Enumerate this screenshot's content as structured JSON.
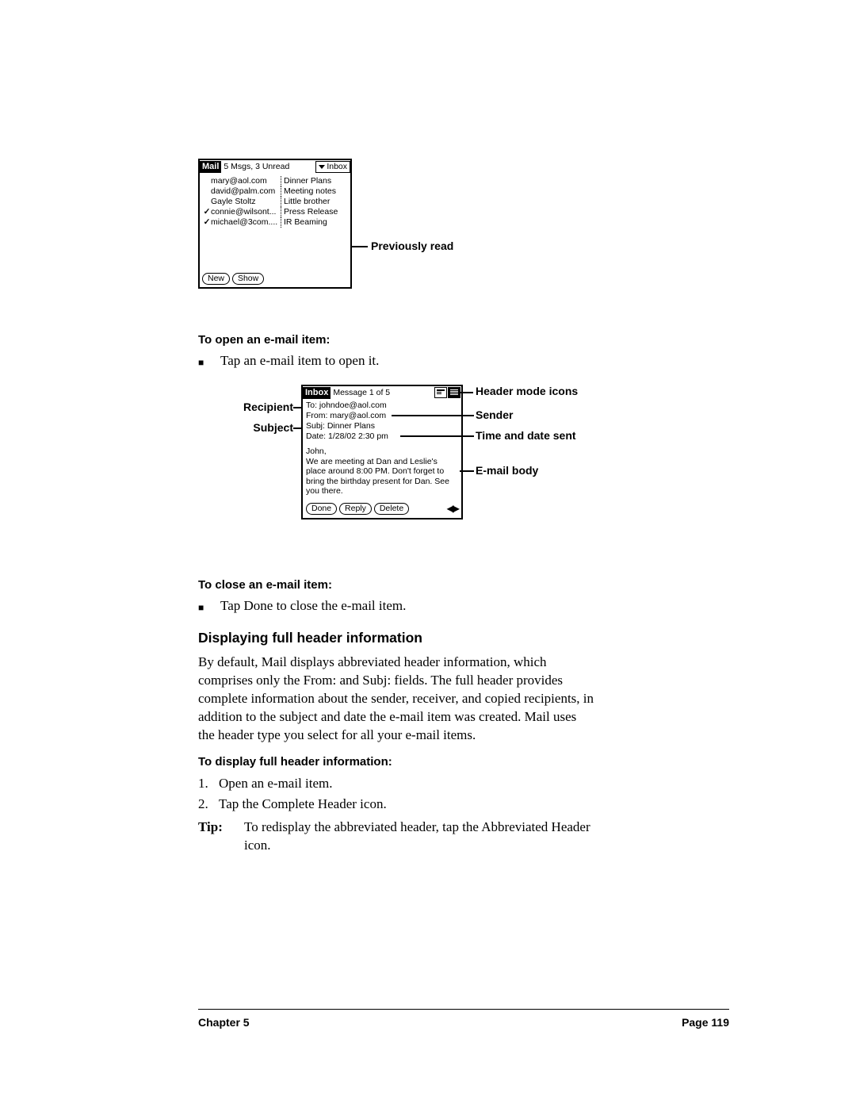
{
  "figure1": {
    "title": "Mail",
    "status": "5 Msgs, 3 Unread",
    "folder": "Inbox",
    "rows": [
      {
        "read": false,
        "sender": "mary@aol.com",
        "subject": "Dinner Plans"
      },
      {
        "read": false,
        "sender": "david@palm.com",
        "subject": "Meeting notes"
      },
      {
        "read": false,
        "sender": "Gayle Stoltz",
        "subject": "Little brother"
      },
      {
        "read": true,
        "sender": "connie@wilsont...",
        "subject": "Press Release"
      },
      {
        "read": true,
        "sender": "michael@3com....",
        "subject": "IR Beaming"
      }
    ],
    "btn_new": "New",
    "btn_show": "Show",
    "callout_read": "Previously read"
  },
  "open_heading": "To open an e-mail item:",
  "open_bullet": "Tap an e-mail item to open it.",
  "figure2": {
    "title": "Inbox",
    "count": "Message 1 of 5",
    "to_line": "To:  johndoe@aol.com",
    "from_line": "From:  mary@aol.com",
    "subj_line": "Subj:  Dinner Plans",
    "date_line": "Date:  1/28/02 2:30 pm",
    "body": "John,\nWe are meeting at Dan and Leslie's place around 8:00 PM.  Don't forget to bring the birthday present for Dan.  See you there.",
    "btn_done": "Done",
    "btn_reply": "Reply",
    "btn_delete": "Delete",
    "callouts": {
      "header_icons": "Header mode icons",
      "recipient": "Recipient",
      "sender": "Sender",
      "subject": "Subject",
      "time": "Time and date sent",
      "body": "E-mail body"
    }
  },
  "close_heading": "To close an e-mail item:",
  "close_bullet": "Tap Done to close the e-mail item.",
  "section_heading": "Displaying full header information",
  "section_para": "By default, Mail displays abbreviated header information, which comprises only the From: and Subj: fields. The full header provides complete information about the sender, receiver, and copied recipients, in addition to the subject and date the e-mail item was created. Mail uses the header type you select for all your e-mail items.",
  "display_heading": "To display full header information:",
  "steps": [
    "Open an e-mail item.",
    "Tap the Complete Header icon."
  ],
  "tip_label": "Tip:",
  "tip_text": "To redisplay the abbreviated header, tap the Abbreviated Header icon.",
  "footer_chapter": "Chapter 5",
  "footer_page": "Page 119"
}
